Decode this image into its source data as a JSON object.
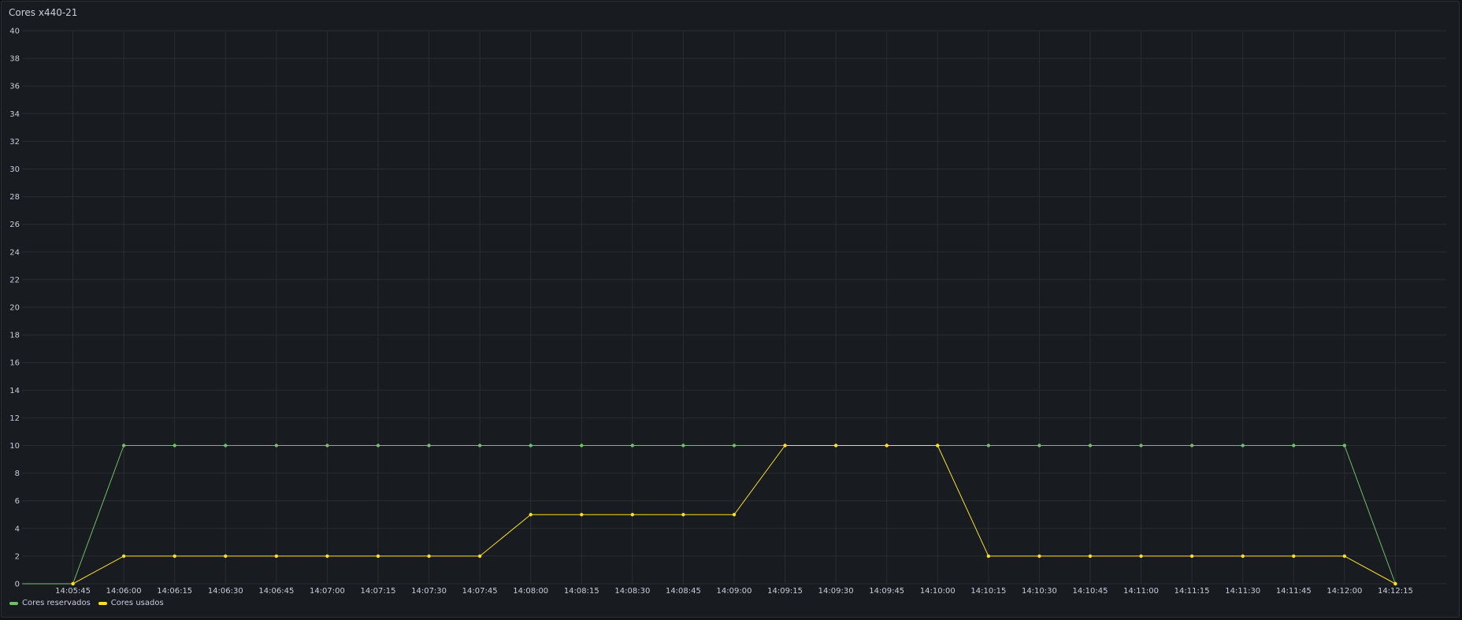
{
  "panel": {
    "title": "Cores x440-21"
  },
  "colors": {
    "reservados": "#73bf69",
    "usados": "#fade2a",
    "grid": "#2a2d33",
    "axis_text": "#ccccdc"
  },
  "chart_data": {
    "type": "line",
    "title": "Cores x440-21",
    "xlabel": "",
    "ylabel": "",
    "ylim": [
      0,
      40
    ],
    "yticks": [
      0,
      2,
      4,
      6,
      8,
      10,
      12,
      14,
      16,
      18,
      20,
      22,
      24,
      26,
      28,
      30,
      32,
      34,
      36,
      38,
      40
    ],
    "xlim": [
      "14:05:30",
      "14:12:30"
    ],
    "x": [
      "14:05:45",
      "14:06:00",
      "14:06:15",
      "14:06:30",
      "14:06:45",
      "14:07:00",
      "14:07:15",
      "14:07:30",
      "14:07:45",
      "14:08:00",
      "14:08:15",
      "14:08:30",
      "14:08:45",
      "14:09:00",
      "14:09:15",
      "14:09:30",
      "14:09:45",
      "14:10:00",
      "14:10:15",
      "14:10:30",
      "14:10:45",
      "14:11:00",
      "14:11:15",
      "14:11:30",
      "14:11:45",
      "14:12:00",
      "14:12:15"
    ],
    "legend_position": "bottom-left",
    "grid": true,
    "series": [
      {
        "name": "Cores reservados",
        "color": "#73bf69",
        "lead_in_value": 0,
        "values": [
          0,
          10,
          10,
          10,
          10,
          10,
          10,
          10,
          10,
          10,
          10,
          10,
          10,
          10,
          10,
          10,
          10,
          10,
          10,
          10,
          10,
          10,
          10,
          10,
          10,
          10,
          0
        ]
      },
      {
        "name": "Cores usados",
        "color": "#fade2a",
        "lead_in_value": null,
        "values": [
          0,
          2,
          2,
          2,
          2,
          2,
          2,
          2,
          2,
          5,
          5,
          5,
          5,
          5,
          10,
          10,
          10,
          10,
          2,
          2,
          2,
          2,
          2,
          2,
          2,
          2,
          0
        ]
      }
    ]
  }
}
